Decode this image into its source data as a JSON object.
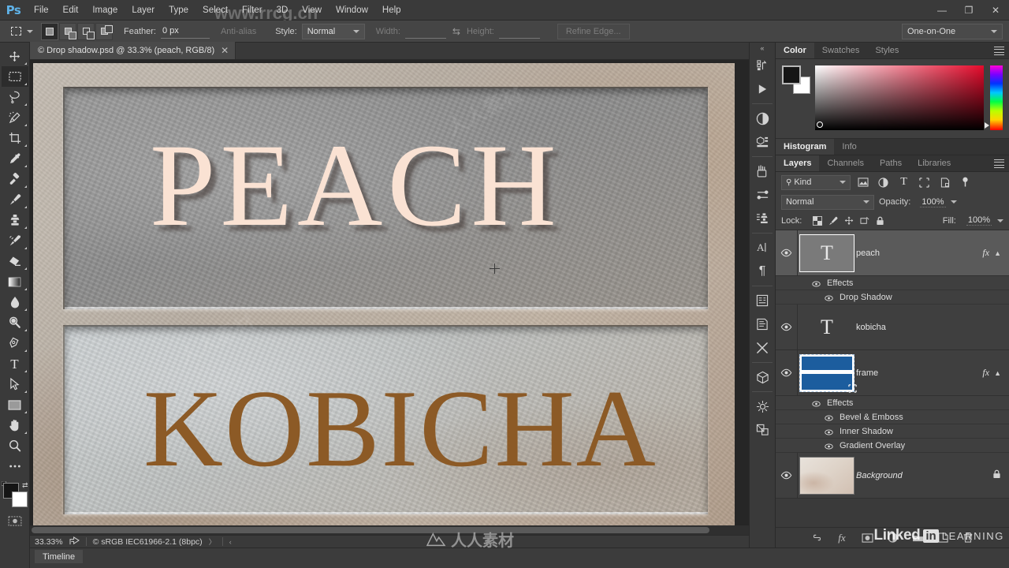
{
  "app": {
    "name": "Ps"
  },
  "menubar": {
    "items": [
      "File",
      "Edit",
      "Image",
      "Layer",
      "Type",
      "Select",
      "Filter",
      "3D",
      "View",
      "Window",
      "Help"
    ]
  },
  "window_controls": {
    "minimize": "—",
    "restore": "❐",
    "close": "✕"
  },
  "options_bar": {
    "tool": "rectangular-marquee",
    "selection_modes": [
      "new-selection",
      "add-to-selection",
      "subtract-from-selection",
      "intersect-with-selection"
    ],
    "active_selection_mode": "new-selection",
    "feather_label": "Feather:",
    "feather_value": "0 px",
    "antialias_label": "Anti-alias",
    "style_label": "Style:",
    "style_value": "Normal",
    "width_label": "Width:",
    "width_value": "",
    "height_label": "Height:",
    "height_value": "",
    "refine_edge_label": "Refine Edge...",
    "workspace": "One-on-One"
  },
  "toolbar": {
    "tools": [
      {
        "name": "move-tool",
        "active": false
      },
      {
        "name": "rectangular-marquee-tool",
        "active": true
      },
      {
        "name": "lasso-tool",
        "active": false
      },
      {
        "name": "quick-selection-tool",
        "active": false
      },
      {
        "name": "crop-tool",
        "active": false
      },
      {
        "name": "eyedropper-tool",
        "active": false
      },
      {
        "name": "spot-healing-brush-tool",
        "active": false
      },
      {
        "name": "brush-tool",
        "active": false
      },
      {
        "name": "clone-stamp-tool",
        "active": false
      },
      {
        "name": "history-brush-tool",
        "active": false
      },
      {
        "name": "eraser-tool",
        "active": false
      },
      {
        "name": "gradient-tool",
        "active": false
      },
      {
        "name": "blur-tool",
        "active": false
      },
      {
        "name": "dodge-tool",
        "active": false
      },
      {
        "name": "pen-tool",
        "active": false
      },
      {
        "name": "horizontal-type-tool",
        "active": false
      },
      {
        "name": "path-selection-tool",
        "active": false
      },
      {
        "name": "rectangle-tool",
        "active": false
      },
      {
        "name": "hand-tool",
        "active": false
      },
      {
        "name": "zoom-tool",
        "active": false
      },
      {
        "name": "edit-toolbar-tool",
        "active": false
      }
    ],
    "foreground_color": "#151515",
    "background_color": "#ffffff"
  },
  "document": {
    "tab_title": "© Drop shadow.psd @ 33.3% (peach, RGB/8)",
    "close_glyph": "✕"
  },
  "canvas": {
    "top_plate_text": "PEACH",
    "bottom_plate_text": "KOBICHA",
    "peach_color": "#fae2d3",
    "kobicha_color": "#8c5a26",
    "cursor": "crosshair"
  },
  "statusbar": {
    "zoom": "33.33%",
    "share_icon": "share-icon",
    "color_profile": "© sRGB IEC61966-2.1 (8bpc)",
    "next_arrow": "〉",
    "prev_arrow": "‹"
  },
  "timeline": {
    "tab_label": "Timeline"
  },
  "icon_dock": {
    "collapse_glyph": "«",
    "icons": [
      "history-icon",
      "actions-play-icon",
      "adjustments-icon",
      "3d-properties-icon",
      "brushes-icon",
      "brush-settings-icon",
      "clone-source-icon",
      "character-icon",
      "paragraph-icon",
      "character-styles-icon",
      "paragraph-styles-icon",
      "tool-presets-icon",
      "3d-icon",
      "timeline-icon",
      "layer-comps-icon"
    ]
  },
  "color_panel": {
    "tabs": [
      "Color",
      "Swatches",
      "Styles"
    ],
    "active_tab": "Color",
    "foreground": "#151515",
    "background": "#ffffff"
  },
  "histogram_panel": {
    "tabs": [
      "Histogram",
      "Info"
    ],
    "active_tab": "Histogram"
  },
  "layers_panel": {
    "tabs": [
      "Layers",
      "Channels",
      "Paths",
      "Libraries"
    ],
    "active_tab": "Layers",
    "filter_kind_label": "Kind",
    "filter_icons": [
      "pixel-filter-icon",
      "adjustment-filter-icon",
      "type-filter-icon",
      "shape-filter-icon",
      "smartobject-filter-icon",
      "filter-toggle-icon"
    ],
    "blend_mode": "Normal",
    "opacity_label": "Opacity:",
    "opacity_value": "100%",
    "lock_label": "Lock:",
    "lock_icons": [
      "lock-transparent-pixels-icon",
      "lock-image-pixels-icon",
      "lock-position-icon",
      "lock-artboard-icon",
      "lock-all-icon"
    ],
    "fill_label": "Fill:",
    "fill_value": "100%",
    "layers": [
      {
        "name": "peach",
        "type": "type-layer",
        "selected": true,
        "visible": true,
        "has_fx": true,
        "fx_glyph": "fx",
        "effects_label": "Effects",
        "effects": [
          "Drop Shadow"
        ]
      },
      {
        "name": "kobicha",
        "type": "type-layer",
        "selected": false,
        "visible": true,
        "has_fx": false,
        "effects_label": "",
        "effects": []
      },
      {
        "name": "frame",
        "type": "shape-layer",
        "selected": false,
        "visible": true,
        "has_fx": true,
        "fx_glyph": "fx",
        "effects_label": "Effects",
        "effects": [
          "Bevel & Emboss",
          "Inner Shadow",
          "Gradient Overlay"
        ]
      },
      {
        "name": "Background",
        "type": "image-layer",
        "selected": false,
        "visible": true,
        "has_fx": false,
        "locked": true,
        "effects_label": "",
        "effects": []
      }
    ],
    "footer_icons": [
      "link-layers-icon",
      "add-layer-style-icon",
      "add-layer-mask-icon",
      "new-adjustment-layer-icon",
      "new-group-icon",
      "new-layer-icon",
      "delete-layer-icon"
    ],
    "footer_fx_glyph": "fx"
  },
  "branding": {
    "linked": "Linked",
    "in": "in",
    "learning": "LEARNING"
  },
  "watermarks": {
    "top": "www.rrcg.cn",
    "bottom": "人人素材"
  }
}
